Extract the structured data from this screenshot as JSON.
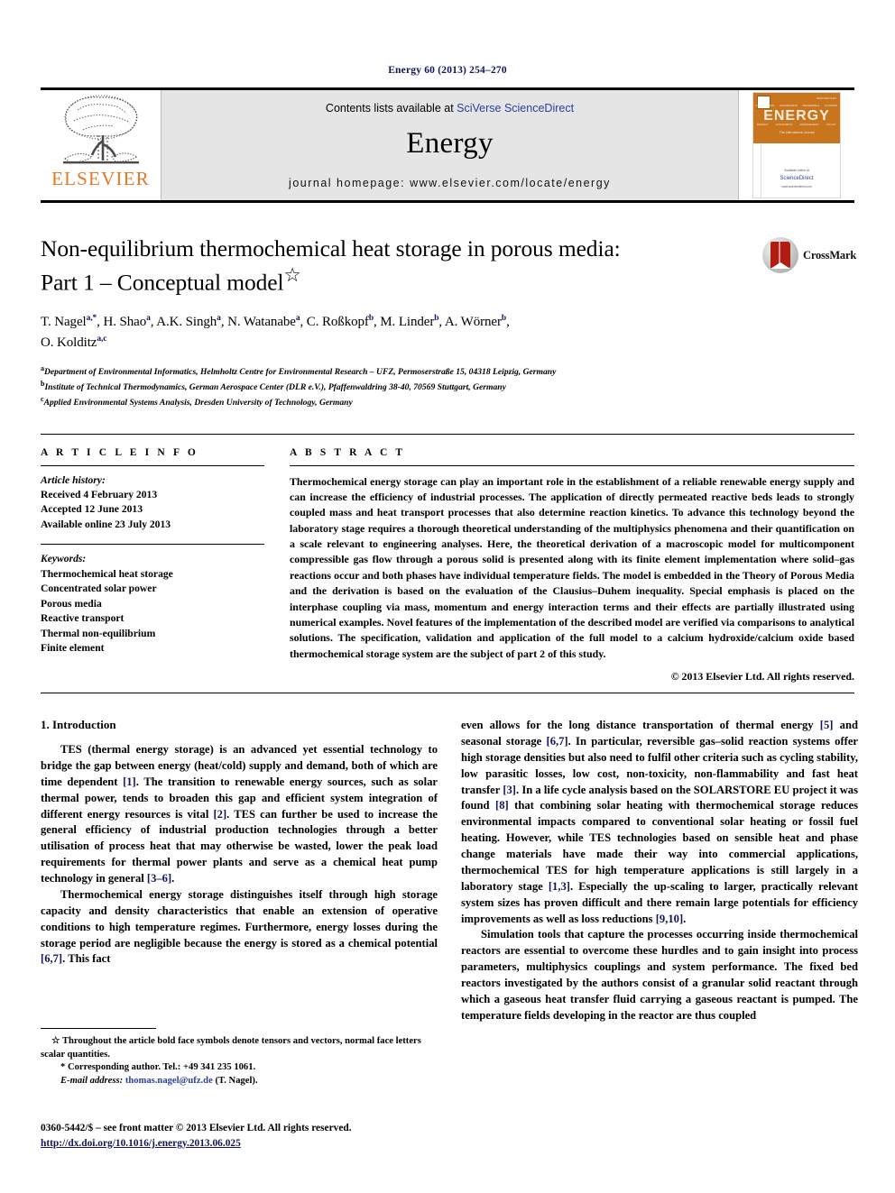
{
  "running_head": "Energy 60 (2013) 254–270",
  "masthead": {
    "publisher_name": "ELSEVIER",
    "contents_prefix": "Contents lists available at ",
    "contents_link": "SciVerse ScienceDirect",
    "journal_name": "Energy",
    "homepage": "journal homepage: www.elsevier.com/locate/energy",
    "cover": {
      "title_word": "ENERGY",
      "subtitle": "The International Journal",
      "issn": "ISSN 0360-5442",
      "available_line": "Available online at",
      "science_direct": "ScienceDirect",
      "sd_url": "www.sciencedirect.com",
      "tags_top": [
        "COMBUSTION",
        "CONVERSION",
        "RENEWABLE",
        "SYSTEMS"
      ],
      "tags_bottom": [
        "ENERGY",
        "ECONOMICS",
        "MANAGEMENT",
        "POLICY"
      ]
    }
  },
  "article": {
    "title_line1": "Non-equilibrium thermochemical heat storage in porous media:",
    "title_line2": "Part 1 – Conceptual model",
    "title_marker": "☆",
    "crossmark_label": "CrossMark",
    "authors": "T. Nagel a,*, H. Shao a, A.K. Singh a, N. Watanabe a, C. Roßkopf b, M. Linder b, A. Wörner b, O. Kolditz a,c",
    "affiliations": [
      {
        "mark": "a",
        "text": "Department of Environmental Informatics, Helmholtz Centre for Environmental Research – UFZ, Permoserstraße 15, 04318 Leipzig, Germany"
      },
      {
        "mark": "b",
        "text": "Institute of Technical Thermodynamics, German Aerospace Center (DLR e.V.), Pfaffenwaldring 38-40, 70569 Stuttgart, Germany"
      },
      {
        "mark": "c",
        "text": "Applied Environmental Systems Analysis, Dresden University of Technology, Germany"
      }
    ]
  },
  "article_info": {
    "heading": "A R T I C L E   I N F O",
    "history_label": "Article history:",
    "history": [
      "Received 4 February 2013",
      "Accepted 12 June 2013",
      "Available online 23 July 2013"
    ],
    "keywords_label": "Keywords:",
    "keywords": [
      "Thermochemical heat storage",
      "Concentrated solar power",
      "Porous media",
      "Reactive transport",
      "Thermal non-equilibrium",
      "Finite element"
    ]
  },
  "abstract": {
    "heading": "A B S T R A C T",
    "text": "Thermochemical energy storage can play an important role in the establishment of a reliable renewable energy supply and can increase the efficiency of industrial processes. The application of directly permeated reactive beds leads to strongly coupled mass and heat transport processes that also determine reaction kinetics. To advance this technology beyond the laboratory stage requires a thorough theoretical understanding of the multiphysics phenomena and their quantification on a scale relevant to engineering analyses. Here, the theoretical derivation of a macroscopic model for multicomponent compressible gas flow through a porous solid is presented along with its finite element implementation where solid–gas reactions occur and both phases have individual temperature fields. The model is embedded in the Theory of Porous Media and the derivation is based on the evaluation of the Clausius–Duhem inequality. Special emphasis is placed on the interphase coupling via mass, momentum and energy interaction terms and their effects are partially illustrated using numerical examples. Novel features of the implementation of the described model are verified via comparisons to analytical solutions. The specification, validation and application of the full model to a calcium hydroxide/calcium oxide based thermochemical storage system are the subject of part 2 of this study.",
    "copyright": "© 2013 Elsevier Ltd. All rights reserved."
  },
  "body": {
    "section_number_title": "1.  Introduction",
    "left_paragraphs": [
      "TES (thermal energy storage) is an advanced yet essential technology to bridge the gap between energy (heat/cold) supply and demand, both of which are time dependent [1]. The transition to renewable energy sources, such as solar thermal power, tends to broaden this gap and efficient system integration of different energy resources is vital [2]. TES can further be used to increase the general efficiency of industrial production technologies through a better utilisation of process heat that may otherwise be wasted, lower the peak load requirements for thermal power plants and serve as a chemical heat pump technology in general [3–6].",
      "Thermochemical energy storage distinguishes itself through high storage capacity and density characteristics that enable an extension of operative conditions to high temperature regimes. Furthermore, energy losses during the storage period are negligible because the energy is stored as a chemical potential [6,7]. This fact"
    ],
    "right_paragraphs": [
      "even allows for the long distance transportation of thermal energy [5] and seasonal storage [6,7]. In particular, reversible gas–solid reaction systems offer high storage densities but also need to fulfil other criteria such as cycling stability, low parasitic losses, low cost, non-toxicity, non-flammability and fast heat transfer [3]. In a life cycle analysis based on the SOLARSTORE EU project it was found [8] that combining solar heating with thermochemical storage reduces environmental impacts compared to conventional solar heating or fossil fuel heating. However, while TES technologies based on sensible heat and phase change materials have made their way into commercial applications, thermochemical TES for high temperature applications is still largely in a laboratory stage [1,3]. Especially the up-scaling to larger, practically relevant system sizes has proven difficult and there remain large potentials for efficiency improvements as well as loss reductions [9,10].",
      "Simulation tools that capture the processes occurring inside thermochemical reactors are essential to overcome these hurdles and to gain insight into process parameters, multiphysics couplings and system performance. The fixed bed reactors investigated by the authors consist of a granular solid reactant through which a gaseous heat transfer fluid carrying a gaseous reactant is pumped. The temperature fields developing in the reactor are thus coupled"
    ]
  },
  "footnotes": {
    "star_note": "☆ Throughout the article bold face symbols denote tensors and vectors, normal face letters scalar quantities.",
    "corresponding": "* Corresponding author. Tel.: +49 341 235 1061.",
    "email_label": "E-mail address:",
    "email": "thomas.nagel@ufz.de",
    "email_suffix": "(T. Nagel)."
  },
  "imprint": {
    "line1": "0360-5442/$ – see front matter © 2013 Elsevier Ltd. All rights reserved.",
    "doi": "http://dx.doi.org/10.1016/j.energy.2013.06.025"
  },
  "colors": {
    "link_blue": "#2a3fa0",
    "ref_blue": "#13145e",
    "elsevier_orange": "#E87722",
    "band_gray": "#e5e5e5",
    "crossmark_red": "#b21d13"
  }
}
